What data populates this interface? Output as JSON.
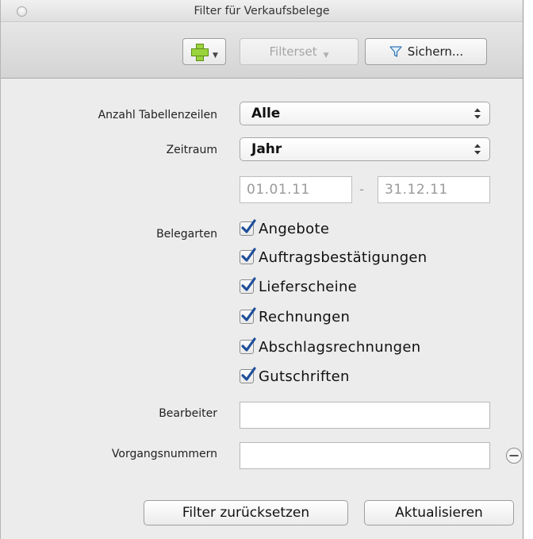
{
  "window": {
    "title": "Filter für Verkaufsbelege"
  },
  "toolbar": {
    "add_icon": "green-plus-icon",
    "filterset_label": "Filterset",
    "save_label": "Sichern...",
    "save_icon": "funnel-icon"
  },
  "form": {
    "rows_label": "Anzahl Tabellenzeilen",
    "rows_value": "Alle",
    "period_label": "Zeitraum",
    "period_value": "Jahr",
    "date_from": "01.01.11",
    "date_separator": "-",
    "date_to": "31.12.11",
    "doctypes_label": "Belegarten",
    "doctypes": [
      {
        "label": "Angebote",
        "checked": true
      },
      {
        "label": "Auftragsbestätigungen",
        "checked": true
      },
      {
        "label": "Lieferscheine",
        "checked": true
      },
      {
        "label": "Rechnungen",
        "checked": true
      },
      {
        "label": "Abschlagsrechnungen",
        "checked": true
      },
      {
        "label": "Gutschriften",
        "checked": true
      }
    ],
    "editor_label": "Bearbeiter",
    "editor_value": "",
    "process_label": "Vorgangsnummern",
    "process_value": ""
  },
  "buttons": {
    "reset_label": "Filter zurücksetzen",
    "refresh_label": "Aktualisieren"
  },
  "colors": {
    "checkmark": "#1f4f9a",
    "plus_green": "#9ad33c"
  }
}
